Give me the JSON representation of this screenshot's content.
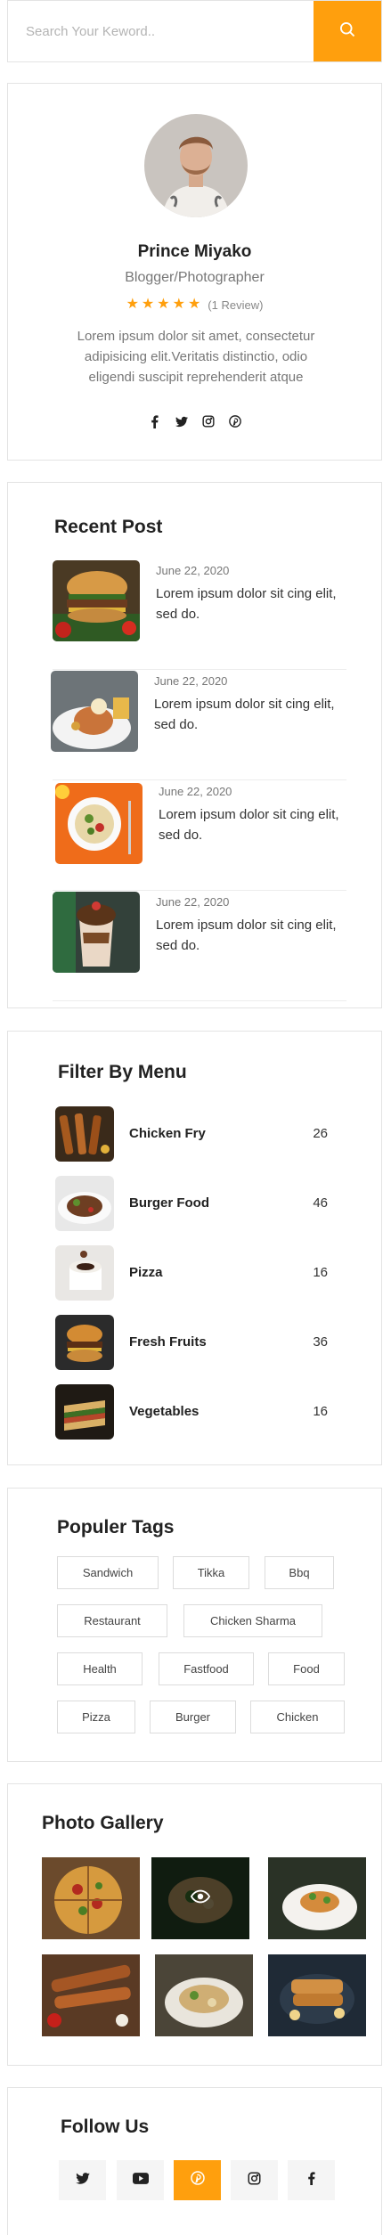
{
  "search": {
    "placeholder": "Search Your Keword.."
  },
  "profile": {
    "name": "Prince Miyako",
    "role": "Blogger/Photographer",
    "rating": 5,
    "review_text": "(1 Review)",
    "bio": "Lorem ipsum dolor sit amet, consectetur adipisicing elit.Veritatis distinctio, odio eligendi suscipit reprehenderit atque",
    "social": [
      "facebook-icon",
      "twitter-icon",
      "instagram-icon",
      "pinterest-icon"
    ]
  },
  "recent": {
    "title": "Recent Post",
    "posts": [
      {
        "date": "June 22, 2020",
        "title": "Lorem ipsum dolor sit cing elit, sed do."
      },
      {
        "date": "June 22, 2020",
        "title": "Lorem ipsum dolor sit cing elit, sed do."
      },
      {
        "date": "June 22, 2020",
        "title": "Lorem ipsum dolor sit cing elit, sed do."
      },
      {
        "date": "June 22, 2020",
        "title": "Lorem ipsum dolor sit cing elit, sed do."
      }
    ]
  },
  "filter": {
    "title": "Filter By Menu",
    "items": [
      {
        "label": "Chicken Fry",
        "count": "26"
      },
      {
        "label": "Burger Food",
        "count": "46"
      },
      {
        "label": "Pizza",
        "count": "16"
      },
      {
        "label": "Fresh Fruits",
        "count": "36"
      },
      {
        "label": "Vegetables",
        "count": "16"
      }
    ]
  },
  "tags": {
    "title": "Populer Tags",
    "items": [
      "Sandwich",
      "Tikka",
      "Bbq",
      "Restaurant",
      "Chicken Sharma",
      "Health",
      "Fastfood",
      "Food",
      "Pizza",
      "Burger",
      "Chicken"
    ]
  },
  "gallery": {
    "title": "Photo Gallery"
  },
  "follow": {
    "title": "Follow Us",
    "buttons": [
      "twitter-icon",
      "youtube-icon",
      "pinterest-icon",
      "instagram-icon",
      "facebook-icon"
    ]
  },
  "colors": {
    "accent": "#ff9f0d",
    "border": "#e3e3e3"
  }
}
